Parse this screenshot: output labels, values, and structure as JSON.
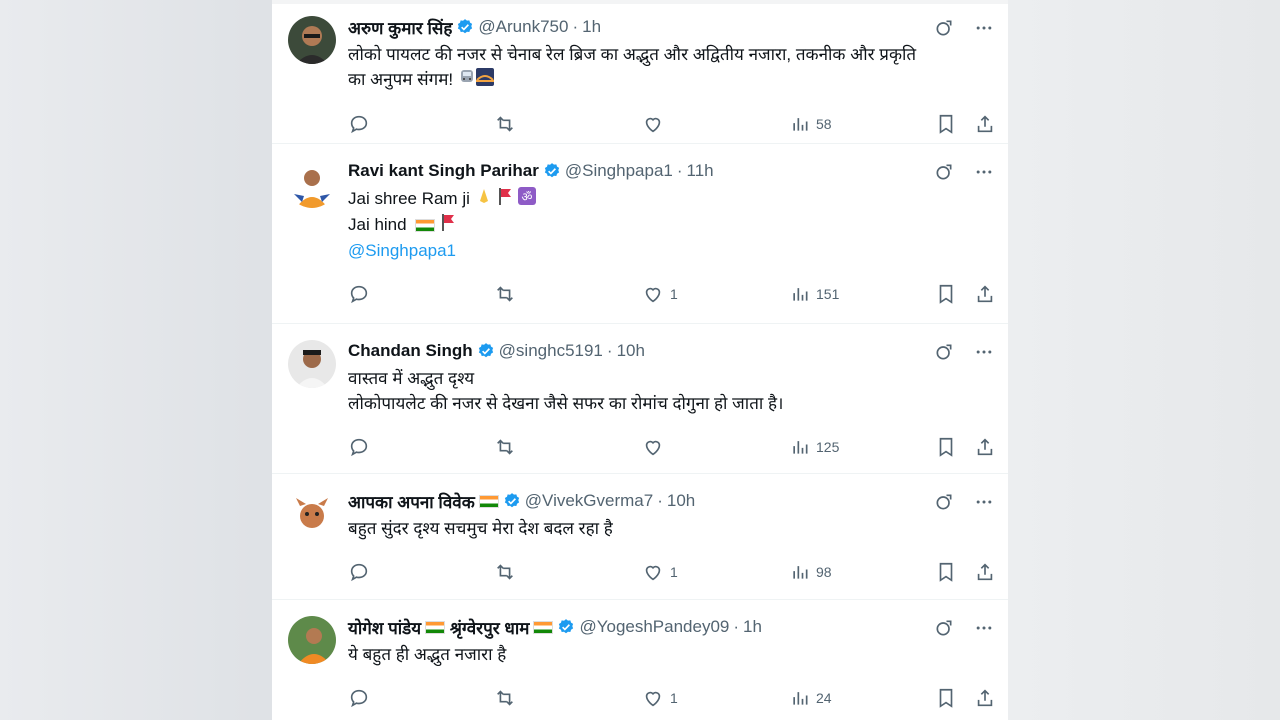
{
  "tweets": [
    {
      "name": "अरुण कुमार सिंह",
      "handle": "@Arunk750",
      "time": "1h",
      "lines": [
        "लोको पायलट की नजर से चेनाब रेल ब्रिज का अद्भुत और अद्वितीय नजारा, तकनीक और प्रकृति",
        "का अनुपम संगम!"
      ],
      "replies": "",
      "retweets": "",
      "likes": "",
      "views": "58"
    },
    {
      "name": "Ravi kant Singh Parihar",
      "handle": "@Singhpapa1",
      "time": "11h",
      "lines": [
        "Jai shree Ram ji",
        "Jai hind"
      ],
      "mention": "@Singhpapa1",
      "replies": "",
      "retweets": "",
      "likes": "1",
      "views": "151"
    },
    {
      "name": "Chandan Singh",
      "handle": "@singhc5191",
      "time": "10h",
      "lines": [
        "वास्तव में अद्भुत दृश्य",
        " लोकोपायलेट की नजर से देखना जैसे सफर का रोमांच दोगुना हो जाता है।"
      ],
      "replies": "",
      "retweets": "",
      "likes": "",
      "views": "125"
    },
    {
      "name": "आपका अपना विवेक",
      "handle": "@VivekGverma7",
      "time": "10h",
      "lines": [
        "बहुत सुंदर दृश्य सचमुच मेरा देश बदल रहा है"
      ],
      "replies": "",
      "retweets": "",
      "likes": "1",
      "views": "98"
    },
    {
      "name_part1": "योगेश पांडेय",
      "name_part2": "श्रृंग्वेरपुर धाम",
      "handle": "@YogeshPandey09",
      "time": "1h",
      "lines": [
        "ये बहुत ही अद्भुत नजारा है"
      ],
      "replies": "",
      "retweets": "",
      "likes": "1",
      "views": "24"
    }
  ],
  "separator": "·",
  "colors": {
    "verified": "#1d9bf0",
    "muted": "#536471",
    "link": "#1d9bf0"
  },
  "icons": [
    "reply-icon",
    "retweet-icon",
    "like-icon",
    "views-icon",
    "bookmark-icon",
    "share-icon",
    "grok-icon",
    "more-icon",
    "verified-icon"
  ]
}
